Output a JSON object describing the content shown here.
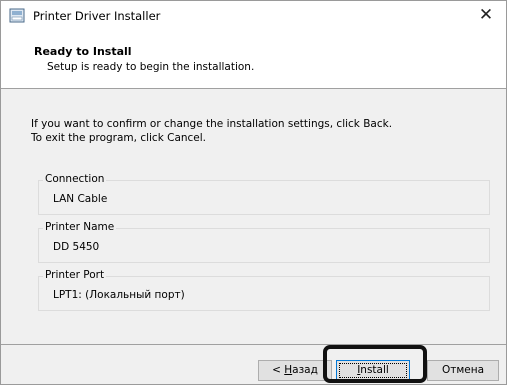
{
  "window": {
    "title": "Printer Driver Installer",
    "close_glyph": "✕"
  },
  "header": {
    "title": "Ready to Install",
    "subtitle": "Setup is ready to begin the installation."
  },
  "info": {
    "line1": "If you want to confirm or change the installation settings, click Back.",
    "line2": "To exit the program, click Cancel."
  },
  "settings": [
    {
      "label": "Connection",
      "value": "LAN Cable"
    },
    {
      "label": "Printer Name",
      "value": "DD 5450"
    },
    {
      "label": "Printer Port",
      "value": "LPT1:  (Локальный порт)"
    }
  ],
  "buttons": {
    "back_prefix": "< ",
    "back_accel": "Н",
    "back_rest": "азад",
    "install_accel": "I",
    "install_rest": "nstall",
    "cancel": "Отмена"
  },
  "colors": {
    "focus_border": "#0078d7",
    "highlight_ring": "#111111"
  }
}
